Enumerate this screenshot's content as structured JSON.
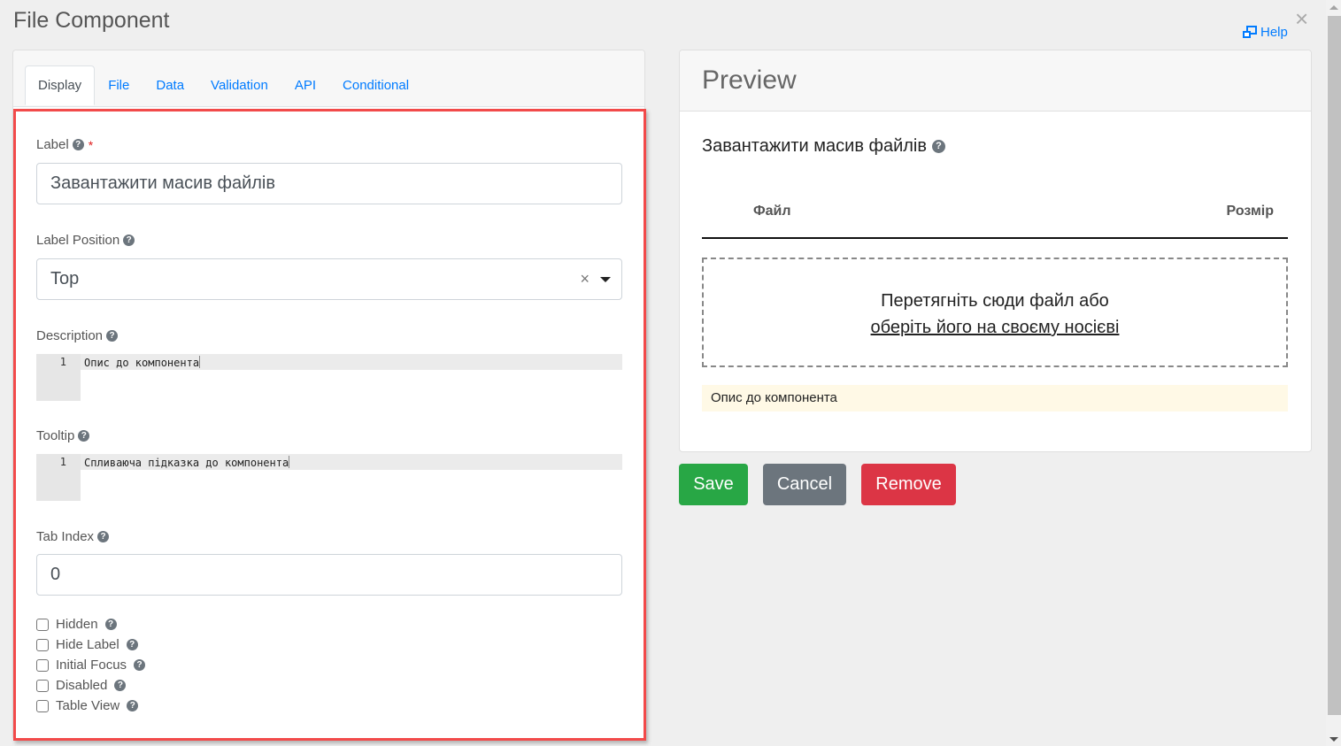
{
  "window": {
    "title": "File Component",
    "help_label": "Help",
    "close_icon": "close-icon"
  },
  "tabs": [
    {
      "label": "Display",
      "active": true
    },
    {
      "label": "File",
      "active": false
    },
    {
      "label": "Data",
      "active": false
    },
    {
      "label": "Validation",
      "active": false
    },
    {
      "label": "API",
      "active": false
    },
    {
      "label": "Conditional",
      "active": false
    }
  ],
  "form": {
    "label": {
      "title": "Label",
      "required_mark": "*",
      "value": "Завантажити масив файлів"
    },
    "label_position": {
      "title": "Label Position",
      "value": "Top",
      "clear_glyph": "×"
    },
    "description": {
      "title": "Description",
      "line_number": "1",
      "value": "Опис до компонента"
    },
    "tooltip": {
      "title": "Tooltip",
      "line_number": "1",
      "value": "Спливаюча підказка до компонента"
    },
    "tab_index": {
      "title": "Tab Index",
      "value": "0"
    },
    "checkboxes": [
      {
        "label": "Hidden",
        "checked": false
      },
      {
        "label": "Hide Label",
        "checked": false
      },
      {
        "label": "Initial Focus",
        "checked": false
      },
      {
        "label": "Disabled",
        "checked": false
      },
      {
        "label": "Table View",
        "checked": false
      }
    ],
    "help_glyph": "?"
  },
  "preview": {
    "title": "Preview",
    "component_label": "Завантажити масив файлів",
    "table_headers": {
      "file": "Файл",
      "size": "Розмір"
    },
    "dropzone": {
      "text": "Перетягніть сюди файл або",
      "link": "оберіть його на своєму носієві"
    },
    "description": "Опис до компонента"
  },
  "buttons": {
    "save": "Save",
    "cancel": "Cancel",
    "remove": "Remove"
  },
  "colors": {
    "save": "#28a745",
    "cancel": "#6c757d",
    "remove": "#dc3545",
    "link": "#007bff",
    "highlight": "#f24a4a"
  }
}
